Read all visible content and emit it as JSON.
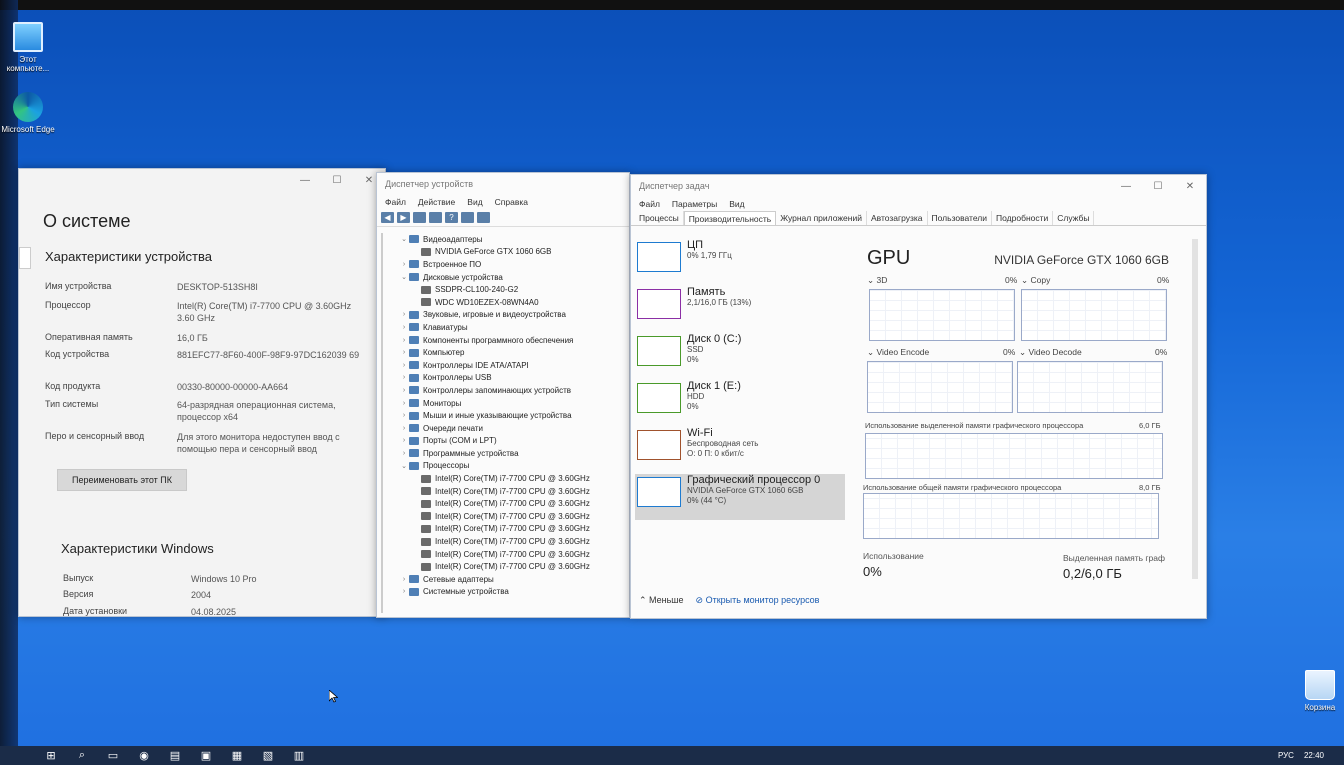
{
  "desktop": {
    "icons": [
      {
        "label": "Этот компьюте...",
        "icon": "computer-icon"
      },
      {
        "label": "Microsoft Edge",
        "icon": "edge-icon"
      },
      {
        "label": "Корзина",
        "icon": "recycle-bin-icon"
      }
    ]
  },
  "about": {
    "title": "О системе",
    "device_header": "Характеристики устройства",
    "specs": [
      {
        "k": "Имя устройства",
        "v": "DESKTOP-513SH8I"
      },
      {
        "k": "Процессор",
        "v": "Intel(R) Core(TM) i7-7700 CPU @ 3.60GHz   3.60 GHz"
      },
      {
        "k": "Оперативная память",
        "v": "16,0 ГБ"
      },
      {
        "k": "Код устройства",
        "v": "881EFC77-8F60-400F-98F9-97DC162039 69"
      },
      {
        "k": "Код продукта",
        "v": "00330-80000-00000-AA664"
      },
      {
        "k": "Тип системы",
        "v": "64-разрядная операционная система, процессор x64"
      },
      {
        "k": "Перо и сенсорный ввод",
        "v": "Для этого монитора недоступен ввод с помощью пера и сенсорный ввод"
      }
    ],
    "rename_button": "Переименовать этот ПК",
    "windows_header": "Характеристики Windows",
    "win_specs": [
      {
        "k": "Выпуск",
        "v": "Windows 10 Pro"
      },
      {
        "k": "Версия",
        "v": "2004"
      },
      {
        "k": "Дата установки",
        "v": "04.08.2025"
      }
    ]
  },
  "devmgr": {
    "title": "Диспетчер устройств",
    "menu": [
      "Файл",
      "Действие",
      "Вид",
      "Справка"
    ],
    "tree": [
      {
        "label": "Видеоадаптеры",
        "level": 0,
        "expanded": true
      },
      {
        "label": "NVIDIA GeForce GTX 1060 6GB",
        "level": 1
      },
      {
        "label": "Встроенное ПО",
        "level": 0
      },
      {
        "label": "Дисковые устройства",
        "level": 0,
        "expanded": true
      },
      {
        "label": "SSDPR-CL100-240-G2",
        "level": 1
      },
      {
        "label": "WDC WD10EZEX-08WN4A0",
        "level": 1
      },
      {
        "label": "Звуковые, игровые и видеоустройства",
        "level": 0
      },
      {
        "label": "Клавиатуры",
        "level": 0
      },
      {
        "label": "Компоненты программного обеспечения",
        "level": 0
      },
      {
        "label": "Компьютер",
        "level": 0
      },
      {
        "label": "Контроллеры IDE ATA/ATAPI",
        "level": 0
      },
      {
        "label": "Контроллеры USB",
        "level": 0
      },
      {
        "label": "Контроллеры запоминающих устройств",
        "level": 0
      },
      {
        "label": "Мониторы",
        "level": 0
      },
      {
        "label": "Мыши и иные указывающие устройства",
        "level": 0
      },
      {
        "label": "Очереди печати",
        "level": 0
      },
      {
        "label": "Порты (COM и LPT)",
        "level": 0
      },
      {
        "label": "Программные устройства",
        "level": 0
      },
      {
        "label": "Процессоры",
        "level": 0,
        "expanded": true
      },
      {
        "label": "Intel(R) Core(TM) i7-7700 CPU @ 3.60GHz",
        "level": 1
      },
      {
        "label": "Intel(R) Core(TM) i7-7700 CPU @ 3.60GHz",
        "level": 1
      },
      {
        "label": "Intel(R) Core(TM) i7-7700 CPU @ 3.60GHz",
        "level": 1
      },
      {
        "label": "Intel(R) Core(TM) i7-7700 CPU @ 3.60GHz",
        "level": 1
      },
      {
        "label": "Intel(R) Core(TM) i7-7700 CPU @ 3.60GHz",
        "level": 1
      },
      {
        "label": "Intel(R) Core(TM) i7-7700 CPU @ 3.60GHz",
        "level": 1
      },
      {
        "label": "Intel(R) Core(TM) i7-7700 CPU @ 3.60GHz",
        "level": 1
      },
      {
        "label": "Intel(R) Core(TM) i7-7700 CPU @ 3.60GHz",
        "level": 1
      },
      {
        "label": "Сетевые адаптеры",
        "level": 0
      },
      {
        "label": "Системные устройства",
        "level": 0
      }
    ]
  },
  "taskmgr": {
    "title": "Диспетчер задач",
    "menu": [
      "Файл",
      "Параметры",
      "Вид"
    ],
    "tabs": [
      "Процессы",
      "Производительность",
      "Журнал приложений",
      "Автозагрузка",
      "Пользователи",
      "Подробности",
      "Службы"
    ],
    "active_tab": "Производительность",
    "sidebar": [
      {
        "name": "ЦП",
        "l1": "0% 1,79 ГГц",
        "l2": "",
        "color": "#1e7bd0"
      },
      {
        "name": "Память",
        "l1": "2,1/16,0 ГБ (13%)",
        "l2": "",
        "color": "#8b2fa5"
      },
      {
        "name": "Диск 0 (C:)",
        "l1": "SSD",
        "l2": "0%",
        "color": "#4a9a2a"
      },
      {
        "name": "Диск 1 (E:)",
        "l1": "HDD",
        "l2": "0%",
        "color": "#4a9a2a"
      },
      {
        "name": "Wi-Fi",
        "l1": "Беспроводная сеть",
        "l2": "О: 0 П: 0 кбит/с",
        "color": "#a0522d"
      },
      {
        "name": "Графический процессор 0",
        "l1": "NVIDIA GeForce GTX 1060 6GB",
        "l2": "0% (44 °C)",
        "color": "#1e7bd0"
      }
    ],
    "gpu": {
      "title": "GPU",
      "name": "NVIDIA GeForce GTX 1060 6GB",
      "engines": [
        {
          "name": "3D",
          "pct": "0%"
        },
        {
          "name": "Copy",
          "pct": "0%"
        },
        {
          "name": "Video Encode",
          "pct": "0%"
        },
        {
          "name": "Video Decode",
          "pct": "0%"
        }
      ],
      "dedicated_label": "Использование выделенной памяти графического процессора",
      "dedicated_max": "6,0 ГБ",
      "shared_label": "Использование общей памяти графического процессора",
      "shared_max": "8,0 ГБ",
      "usage_label": "Использование",
      "usage_value": "0%",
      "dedicated_mem_label": "Выделенная память граф",
      "dedicated_mem_value": "0,2/6,0 ГБ"
    },
    "footer": {
      "less": "Меньше",
      "monitor": "Открыть монитор ресурсов"
    }
  },
  "taskbar": {
    "apps": [
      "start-icon",
      "search-icon",
      "task-view-icon",
      "edge-icon",
      "explorer-icon",
      "store-icon",
      "device-manager-icon",
      "system-icon",
      "taskmgr-icon"
    ],
    "lang": "РУС",
    "time": "22:40"
  }
}
